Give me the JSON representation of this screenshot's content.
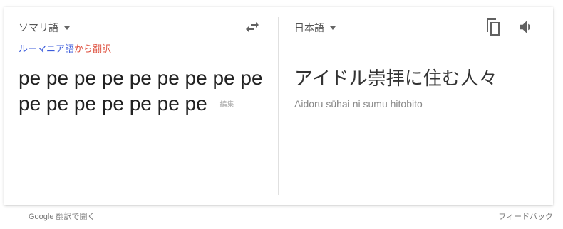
{
  "source": {
    "language": "ソマリ語",
    "translate_from_lang": "ルーマニア語",
    "translate_from_suffix": "から翻訳",
    "text": "pe pe pe pe pe pe pe pe pe pe pe pe pe pe pe pe",
    "edit_label": "編集"
  },
  "target": {
    "language": "日本語",
    "text": "アイドル崇拝に住む人々",
    "romanization": "Aidoru sūhai ni sumu hitobito"
  },
  "icons": {
    "swap": "swap-arrows-icon",
    "copy": "copy-icon",
    "speaker": "speaker-icon",
    "caret": "chevron-down-icon"
  },
  "footer": {
    "open_in_translate": "Google 翻訳で開く",
    "feedback": "フィードバック"
  },
  "colors": {
    "translate_from_lang": "#3b5bdb",
    "translate_from_suffix": "#dd4b39"
  }
}
